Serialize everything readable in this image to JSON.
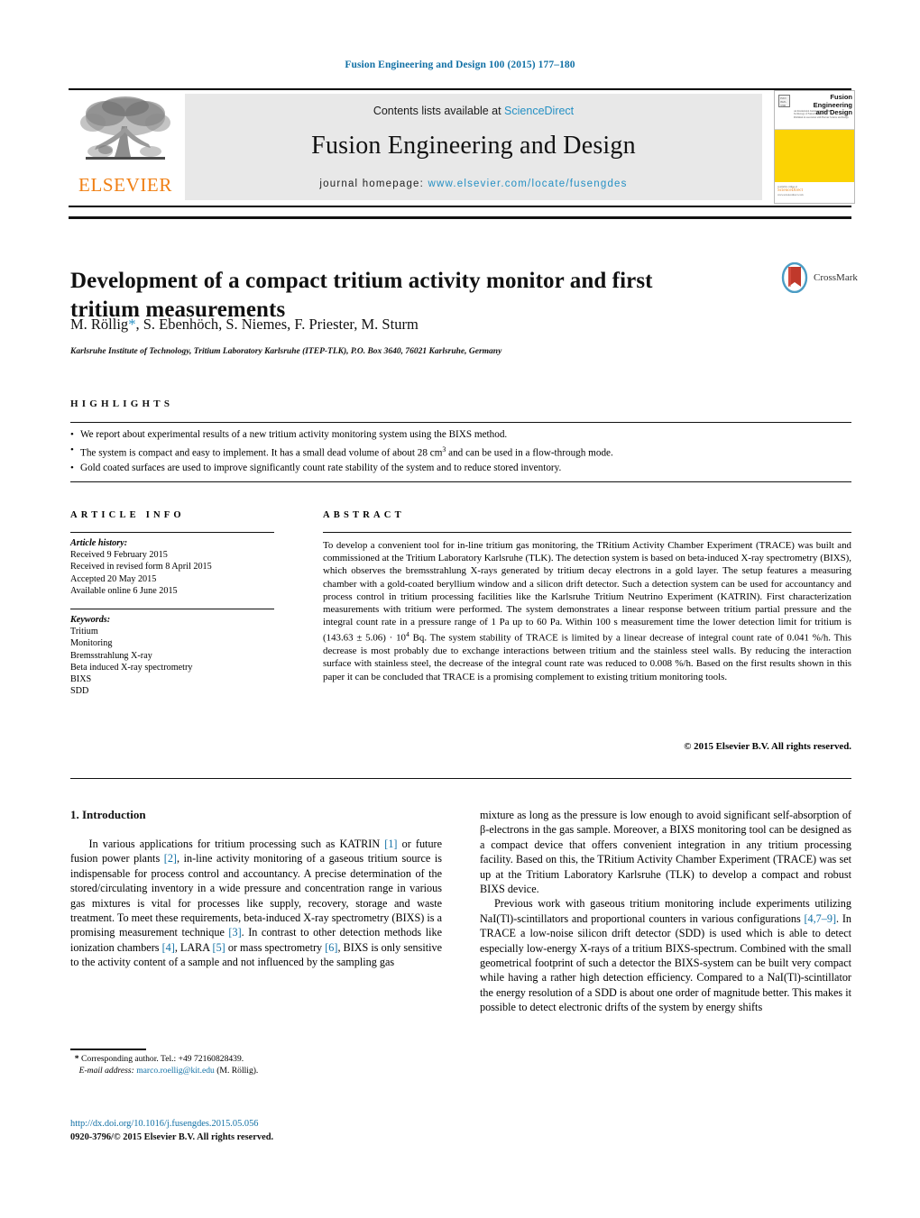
{
  "running_head": "Fusion Engineering and Design 100 (2015) 177–180",
  "masthead": {
    "publisher_name": "ELSEVIER",
    "contents_prefix": "Contents lists available at ",
    "contents_link": "ScienceDirect",
    "journal_name": "Fusion Engineering and Design",
    "homepage_label": "journal homepage:",
    "homepage_url": "www.elsevier.com/locate/fusengdes",
    "cover": {
      "title_line1": "Fusion Engineering",
      "title_line2": "and Design",
      "badge": "ISSN 0920-3796",
      "sub_line1": "An International Journal devoted to the",
      "sub_line2": "Technology of Fusion Research",
      "sub_line3": "Published in association with Elsevier Science and Design",
      "bottom_label": "available online at",
      "bottom_brand": "ScienceDirect",
      "bottom_url": "www.sciencedirect.com"
    }
  },
  "article": {
    "title": "Development of a compact tritium activity monitor and first tritium measurements",
    "authors_pre": "M. Röllig",
    "authors_star": "*",
    "authors_post": ", S. Ebenhöch, S. Niemes, F. Priester, M. Sturm",
    "affiliation": "Karlsruhe Institute of Technology, Tritium Laboratory Karlsruhe (ITEP-TLK), P.O. Box 3640, 76021 Karlsruhe, Germany",
    "crossmark_label": "CrossMark"
  },
  "highlights": {
    "heading": "HIGHLIGHTS",
    "bullet_glyph": "•",
    "items": [
      "We report about experimental results of a new tritium activity monitoring system using the BIXS method.",
      "The system is compact and easy to implement. It has a small dead volume of about 28 cm3 and can be used in a flow-through mode.",
      "Gold coated surfaces are used to improve significantly count rate stability of the system and to reduce stored inventory."
    ],
    "item2_pre": "The system is compact and easy to implement. It has a small dead volume of about 28 cm",
    "item2_sup": "3",
    "item2_post": " and can be used in a flow-through mode."
  },
  "article_info": {
    "heading": "ARTICLE INFO",
    "history_label": "Article history:",
    "history": [
      "Received 9 February 2015",
      "Received in revised form 8 April 2015",
      "Accepted 20 May 2015",
      "Available online 6 June 2015"
    ],
    "keywords_label": "Keywords:",
    "keywords": [
      "Tritium",
      "Monitoring",
      "Bremsstrahlung X-ray",
      "Beta induced X-ray spectrometry",
      "BIXS",
      "SDD"
    ]
  },
  "abstract": {
    "heading": "ABSTRACT",
    "text": "To develop a convenient tool for in-line tritium gas monitoring, the TRitium Activity Chamber Experiment (TRACE) was built and commissioned at the Tritium Laboratory Karlsruhe (TLK). The detection system is based on beta-induced X-ray spectrometry (BIXS), which observes the bremsstrahlung X-rays generated by tritium decay electrons in a gold layer. The setup features a measuring chamber with a gold-coated beryllium window and a silicon drift detector. Such a detection system can be used for accountancy and process control in tritium processing facilities like the Karlsruhe Tritium Neutrino Experiment (KATRIN). First characterization measurements with tritium were performed. The system demonstrates a linear response between tritium partial pressure and the integral count rate in a pressure range of 1 Pa up to 60 Pa. Within 100 s measurement time the lower detection limit for tritium is (143.63 ± 5.06) · 104 Bq. The system stability of TRACE is limited by a linear decrease of integral count rate of 0.041 %/h. This decrease is most probably due to exchange interactions between tritium and the stainless steel walls. By reducing the interaction surface with stainless steel, the decrease of the integral count rate was reduced to 0.008 %/h. Based on the first results shown in this paper it can be concluded that TRACE is a promising complement to existing tritium monitoring tools.",
    "text_part1": "To develop a convenient tool for in-line tritium gas monitoring, the TRitium Activity Chamber Experiment (TRACE) was built and commissioned at the Tritium Laboratory Karlsruhe (TLK). The detection system is based on beta-induced X-ray spectrometry (BIXS), which observes the bremsstrahlung X-rays generated by tritium decay electrons in a gold layer. The setup features a measuring chamber with a gold-coated beryllium window and a silicon drift detector. Such a detection system can be used for accountancy and process control in tritium processing facilities like the Karlsruhe Tritium Neutrino Experiment (KATRIN). First characterization measurements with tritium were performed. The system demonstrates a linear response between tritium partial pressure and the integral count rate in a pressure range of 1 Pa up to 60 Pa. Within 100 s measurement time the lower detection limit for tritium is (143.63 ± 5.06) · 10",
    "text_sup": "4",
    "text_part2": " Bq. The system stability of TRACE is limited by a linear decrease of integral count rate of 0.041 %/h. This decrease is most probably due to exchange interactions between tritium and the stainless steel walls. By reducing the interaction surface with stainless steel, the decrease of the integral count rate was reduced to 0.008 %/h. Based on the first results shown in this paper it can be concluded that TRACE is a promising complement to existing tritium monitoring tools.",
    "copyright": "© 2015 Elsevier B.V. All rights reserved."
  },
  "introduction": {
    "heading": "1. Introduction",
    "left_p1_a": "In various applications for tritium processing such as KATRIN ",
    "left_ref1": "[1]",
    "left_p1_b": " or future fusion power plants ",
    "left_ref2": "[2]",
    "left_p1_c": ", in-line activity monitoring of a gaseous tritium source is indispensable for process control and accountancy. A precise determination of the stored/circulating inventory in a wide pressure and concentration range in various gas mixtures is vital for processes like supply, recovery, storage and waste treatment. To meet these requirements, beta-induced X-ray spectrometry (BIXS) is a promising measurement technique ",
    "left_ref3": "[3]",
    "left_p1_d": ". In contrast to other detection methods like ionization chambers ",
    "left_ref4": "[4]",
    "left_p1_e": ", LARA ",
    "left_ref5": "[5]",
    "left_p1_f": " or mass spectrometry ",
    "left_ref6": "[6]",
    "left_p1_g": ", BIXS is only sensitive to the activity content of a sample and not influenced by the sampling gas",
    "right_p1": "mixture as long as the pressure is low enough to avoid significant self-absorption of β-electrons in the gas sample. Moreover, a BIXS monitoring tool can be designed as a compact device that offers convenient integration in any tritium processing facility. Based on this, the TRitium Activity Chamber Experiment (TRACE) was set up at the Tritium Laboratory Karlsruhe (TLK) to develop a compact and robust BIXS device.",
    "right_p2_a": "Previous work with gaseous tritium monitoring include experiments utilizing NaI(Tl)-scintillators and proportional counters in various configurations ",
    "right_ref79": "[4,7–9]",
    "right_p2_b": ". In TRACE a low-noise silicon drift detector (SDD) is used which is able to detect especially low-energy X-rays of a tritium BIXS-spectrum. Combined with the small geometrical footprint of such a detector the BIXS-system can be built very compact while having a rather high detection efficiency. Compared to a NaI(Tl)-scintillator the energy resolution of a SDD is about one order of magnitude better. This makes it possible to detect electronic drifts of the system by energy shifts"
  },
  "footnote": {
    "star": "*",
    "corresponding": " Corresponding author. Tel.: +49 72160828439.",
    "email_label": "E-mail address:",
    "email": "marco.roellig@kit.edu",
    "email_suffix": " (M. Röllig)."
  },
  "footer": {
    "doi": "http://dx.doi.org/10.1016/j.fusengdes.2015.05.056",
    "issn_line": "0920-3796/© 2015 Elsevier B.V. All rights reserved."
  },
  "colors": {
    "link_blue": "#1170a5",
    "sciencedirect_blue": "#2590c4",
    "elsevier_orange": "#f07f13",
    "cover_yellow": "#fbd303",
    "masthead_gray": "#e8e8e8"
  }
}
